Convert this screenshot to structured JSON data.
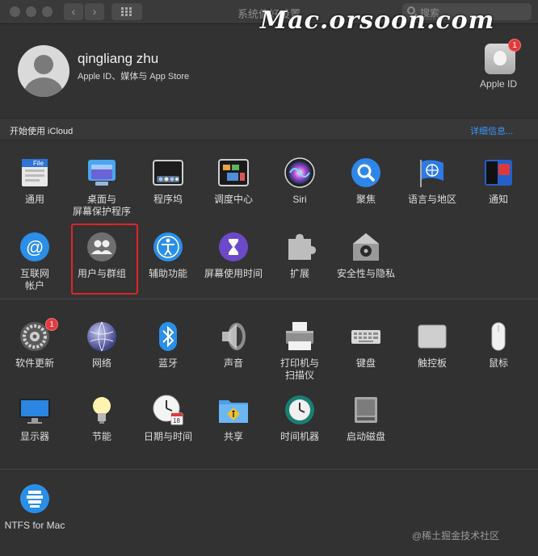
{
  "window": {
    "title": "系统偏好设置",
    "search_placeholder": "搜索"
  },
  "watermark": "Mac.orsoon.com",
  "account": {
    "name": "qingliang zhu",
    "subtitle": "Apple ID、媒体与 App Store",
    "appleid_label": "Apple ID",
    "appleid_badge": "1"
  },
  "icloud": {
    "prompt": "开始使用 iCloud",
    "link": "详细信息..."
  },
  "sections": [
    [
      {
        "label": "通用",
        "icon": "general-icon"
      },
      {
        "label": "桌面与\n屏幕保护程序",
        "icon": "desktop-screensaver-icon"
      },
      {
        "label": "程序坞",
        "icon": "dock-icon"
      },
      {
        "label": "调度中心",
        "icon": "mission-control-icon"
      },
      {
        "label": "Siri",
        "icon": "siri-icon"
      },
      {
        "label": "聚焦",
        "icon": "spotlight-icon"
      },
      {
        "label": "语言与地区",
        "icon": "language-region-icon"
      },
      {
        "label": "通知",
        "icon": "notifications-icon"
      },
      {
        "label": "互联网\n帐户",
        "icon": "internet-accounts-icon"
      },
      {
        "label": "用户与群组",
        "icon": "users-groups-icon",
        "highlighted": true
      },
      {
        "label": "辅助功能",
        "icon": "accessibility-icon"
      },
      {
        "label": "屏幕使用时间",
        "icon": "screen-time-icon"
      },
      {
        "label": "扩展",
        "icon": "extensions-icon"
      },
      {
        "label": "安全性与隐私",
        "icon": "security-privacy-icon"
      }
    ],
    [
      {
        "label": "软件更新",
        "icon": "software-update-icon",
        "badge": "1"
      },
      {
        "label": "网络",
        "icon": "network-icon"
      },
      {
        "label": "蓝牙",
        "icon": "bluetooth-icon"
      },
      {
        "label": "声音",
        "icon": "sound-icon"
      },
      {
        "label": "打印机与\n扫描仪",
        "icon": "printers-scanners-icon"
      },
      {
        "label": "键盘",
        "icon": "keyboard-icon"
      },
      {
        "label": "触控板",
        "icon": "trackpad-icon"
      },
      {
        "label": "鼠标",
        "icon": "mouse-icon"
      },
      {
        "label": "显示器",
        "icon": "displays-icon"
      },
      {
        "label": "节能",
        "icon": "energy-saver-icon"
      },
      {
        "label": "日期与时间",
        "icon": "date-time-icon"
      },
      {
        "label": "共享",
        "icon": "sharing-icon"
      },
      {
        "label": "时间机器",
        "icon": "time-machine-icon"
      },
      {
        "label": "启动磁盘",
        "icon": "startup-disk-icon"
      }
    ],
    [
      {
        "label": "NTFS for Mac",
        "icon": "ntfs-for-mac-icon"
      }
    ]
  ],
  "footer_watermark": "@稀土掘金技术社区",
  "colors": {
    "accent": "#3b95f5",
    "highlight": "#e0242b",
    "badge": "#e5383b"
  }
}
